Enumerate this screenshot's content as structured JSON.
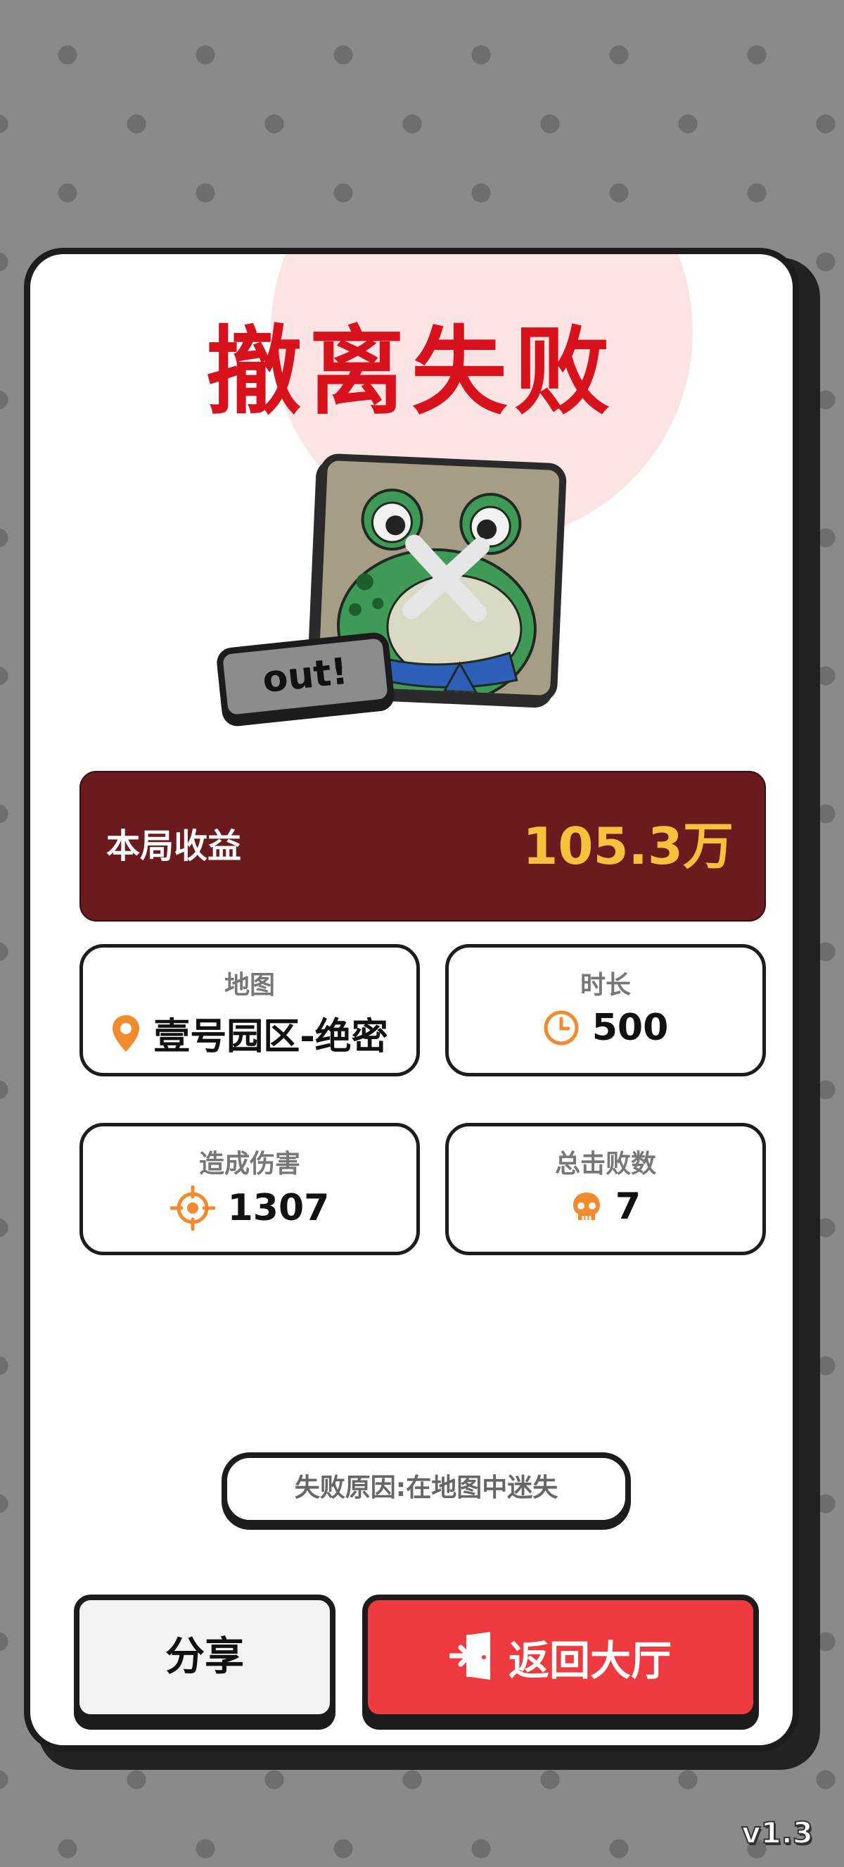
{
  "title": "撤离失败",
  "avatar": {
    "badge": "out!",
    "icon": "frog-avatar"
  },
  "earnings": {
    "label": "本局收益",
    "value": "105.3万"
  },
  "stats": {
    "map": {
      "label": "地图",
      "value": "壹号园区-绝密",
      "icon": "location-pin-icon"
    },
    "duration": {
      "label": "时长",
      "value": "500",
      "icon": "clock-icon"
    },
    "damage": {
      "label": "造成伤害",
      "value": "1307",
      "icon": "crosshair-icon"
    },
    "kills": {
      "label": "总击败数",
      "value": "7",
      "icon": "skull-icon"
    }
  },
  "fail_reason": "失败原因:在地图中迷失",
  "buttons": {
    "share": "分享",
    "return_lobby": "返回大厅"
  },
  "version": "v1.3",
  "colors": {
    "title": "#d8121c",
    "earnings_bg": "#6b1b1e",
    "earnings_value": "#f7c13b",
    "icon_accent": "#f28a2e",
    "primary_button": "#ef3a3f"
  }
}
